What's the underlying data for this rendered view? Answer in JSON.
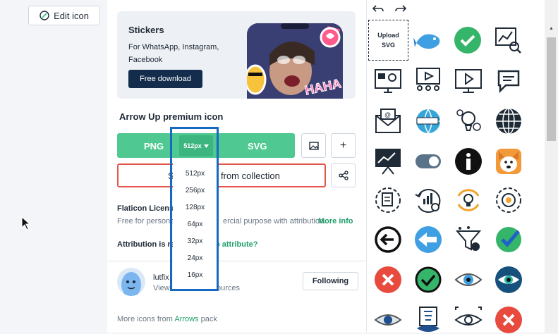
{
  "left_panel": {
    "edit_icon_label": "Edit icon"
  },
  "banner": {
    "title": "Stickers",
    "text": "For WhatsApp, Instagram, Facebook",
    "button": "Free download",
    "sticker_text": "HAHA"
  },
  "icon": {
    "title": "Arrow Up premium icon",
    "png_label": "PNG",
    "svg_label": "SVG",
    "selected_size": "512px",
    "collection_label_visible_a": "S",
    "collection_label_visible_b": "from collection"
  },
  "size_menu": {
    "options": [
      "512px",
      "256px",
      "128px",
      "64px",
      "32px",
      "24px",
      "16px"
    ]
  },
  "license": {
    "title_visible": "Flaticon License",
    "text_visible_a": "Free for personal",
    "text_visible_b": "ercial purpose with attribution.",
    "more_info": "More info",
    "attribution_visible_a": "Attribution is requ",
    "attribution_visible_b": "o attribute?"
  },
  "author": {
    "name_visible": "lutfix",
    "sub_visible_a": "View",
    "sub_visible_b": "ources",
    "follow_label": "Following"
  },
  "footer": {
    "more_prefix": "More icons from ",
    "pack_name": "Arrows",
    "more_suffix": " pack"
  },
  "editor": {
    "upload_label": "Upload SVG",
    "icons": [
      "fish-icon",
      "check-circle-icon",
      "chart-magnifier-icon",
      "dashboard-monitor-icon",
      "video-classroom-icon",
      "video-monitor-icon",
      "chat-bubble-icon",
      "email-icon",
      "web-globe-icon",
      "settings-lightbulb-icon",
      "globe-icon",
      "presentation-chart-icon",
      "toggle-switch-icon",
      "info-circle-icon",
      "dog-icon",
      "gear-document-icon",
      "growth-user-icon",
      "bulb-refresh-icon",
      "target-gear-icon",
      "arrow-left-circle-icon",
      "arrow-left-blue-icon",
      "funnel-icon",
      "check-green-icon",
      "close-red-icon",
      "check-outline-icon",
      "eye-icon",
      "eye-blue-icon",
      "eye-outline-icon",
      "eye-chart-icon",
      "eye-target-icon",
      "close-red-2-icon"
    ]
  },
  "colors": {
    "green": "#4fc991",
    "green_dark": "#3db57f",
    "navy": "#142d4c",
    "highlight_blue": "#1669c1",
    "red_border": "#e2564c"
  }
}
